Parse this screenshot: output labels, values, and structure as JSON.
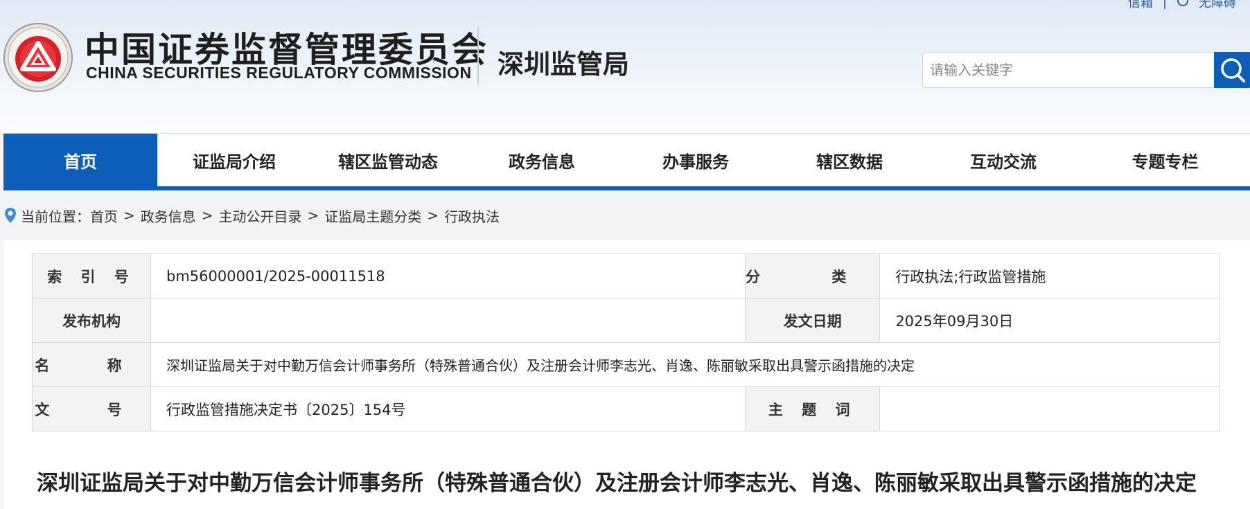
{
  "header": {
    "top_links": [
      "信箱",
      "|",
      "无障碍"
    ],
    "logo_cn": "中国证券监督管理委员会",
    "logo_en": "CHINA SECURITIES REGULATORY COMMISSION",
    "bureau": "深圳监管局",
    "search": {
      "placeholder": "请输入关键字",
      "icon": "search-icon"
    },
    "colors": {
      "brand_blue": "#0d5eb8",
      "seal_red": "#d2232a"
    }
  },
  "nav": {
    "items": [
      {
        "label": "首页",
        "active": true
      },
      {
        "label": "证监局介绍"
      },
      {
        "label": "辖区监管动态"
      },
      {
        "label": "政务信息"
      },
      {
        "label": "办事服务"
      },
      {
        "label": "辖区数据"
      },
      {
        "label": "互动交流"
      },
      {
        "label": "专题专栏"
      }
    ]
  },
  "breadcrumb": {
    "icon": "location-pin-icon",
    "prefix": "当前位置：",
    "items": [
      "首页",
      "政务信息",
      "主动公开目录",
      "证监局主题分类",
      "行政执法"
    ],
    "separator": ">"
  },
  "meta": {
    "index_label": "索 引 号",
    "index_value": "bm56000001/2025-00011518",
    "category_label": "分 类",
    "category_value": "行政执法;行政监管措施",
    "publisher_label": "发布机构",
    "publisher_value": "",
    "date_label": "发文日期",
    "date_value": "2025年09月30日",
    "name_label": "名 称",
    "name_value": "深圳证监局关于对中勤万信会计师事务所（特殊普通合伙）及注册会计师李志光、肖逸、陈丽敏采取出具警示函措施的决定",
    "docno_label": "文 号",
    "docno_value": "行政监管措施决定书〔2025〕154号",
    "keywords_label": "主 题 词",
    "keywords_value": ""
  },
  "document": {
    "title": "深圳证监局关于对中勤万信会计师事务所（特殊普通合伙）及注册会计师李志光、肖逸、陈丽敏采取出具警示函措施的决定"
  }
}
